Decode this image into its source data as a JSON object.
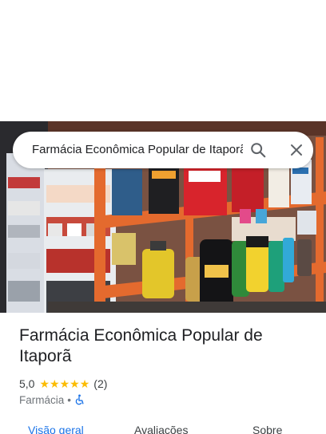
{
  "search": {
    "query": "Farmácia Econômica Popular de Itaporã"
  },
  "place": {
    "title": "Farmácia Econômica Popular de Itaporã",
    "rating": "5,0",
    "stars": 5,
    "review_count": "(2)",
    "category": "Farmácia",
    "separator": "•"
  },
  "tabs": [
    {
      "label": "Visão geral",
      "active": true
    },
    {
      "label": "Avaliações",
      "active": false
    },
    {
      "label": "Sobre",
      "active": false
    }
  ],
  "icons": {
    "search": "search-icon",
    "close": "close-icon",
    "star": "star-icon",
    "accessibility": "wheelchair-icon"
  },
  "colors": {
    "accent": "#1a73e8",
    "star": "#fbbc04"
  }
}
